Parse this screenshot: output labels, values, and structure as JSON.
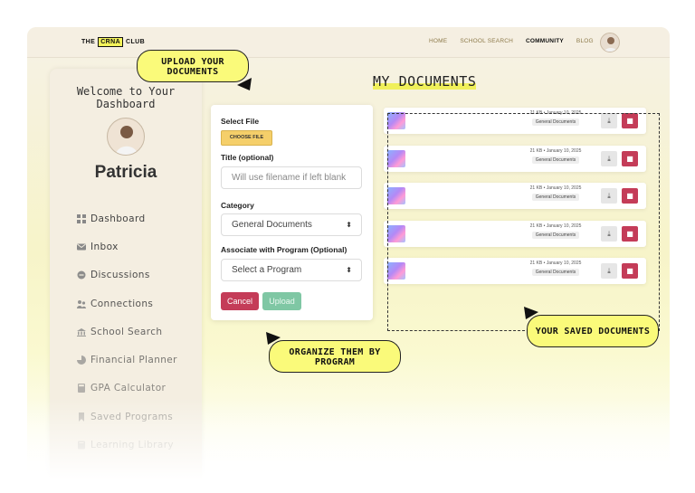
{
  "header": {
    "logo_prefix": "THE",
    "logo_box": "CRNA",
    "logo_suffix": "CLUB",
    "nav": [
      "HOME",
      "SCHOOL SEARCH",
      "COMMUNITY",
      "BLOG"
    ],
    "active_nav": "COMMUNITY"
  },
  "sidebar": {
    "welcome": "Welcome to Your Dashboard",
    "username": "Patricia",
    "items": [
      {
        "label": "Dashboard",
        "icon": "grid-icon"
      },
      {
        "label": "Inbox",
        "icon": "mail-icon"
      },
      {
        "label": "Discussions",
        "icon": "chat-icon"
      },
      {
        "label": "Connections",
        "icon": "people-icon"
      },
      {
        "label": "School Search",
        "icon": "school-icon"
      },
      {
        "label": "Financial Planner",
        "icon": "pie-icon"
      },
      {
        "label": "GPA Calculator",
        "icon": "calculator-icon"
      },
      {
        "label": "Saved Programs",
        "icon": "bookmark-icon"
      },
      {
        "label": "Learning Library",
        "icon": "book-icon"
      }
    ]
  },
  "upload_form": {
    "select_file_label": "Select File",
    "choose_file_button": "CHOOSE FILE",
    "title_label": "Title (optional)",
    "title_placeholder": "Will use filename if left blank",
    "category_label": "Category",
    "category_value": "General Documents",
    "program_label": "Associate with Program (Optional)",
    "program_value": "Select a Program",
    "cancel_label": "Cancel",
    "upload_label": "Upload"
  },
  "documents": {
    "heading": "MY DOCUMENTS",
    "items": [
      {
        "meta": "21 KB • January 10, 2025",
        "category": "General Documents"
      },
      {
        "meta": "21 KB • January 10, 2025",
        "category": "General Documents"
      },
      {
        "meta": "21 KB • January 10, 2025",
        "category": "General Documents"
      },
      {
        "meta": "21 KB • January 10, 2025",
        "category": "General Documents"
      },
      {
        "meta": "21 KB • January 10, 2025",
        "category": "General Documents"
      }
    ]
  },
  "callouts": {
    "upload": "UPLOAD YOUR DOCUMENTS",
    "organize": "ORGANIZE THEM BY PROGRAM",
    "saved": "YOUR SAVED DOCUMENTS"
  },
  "colors": {
    "accent_yellow": "#f3f35a",
    "danger": "#c43c58",
    "success": "#7fc7a4",
    "choose_file": "#f5cf6a"
  }
}
